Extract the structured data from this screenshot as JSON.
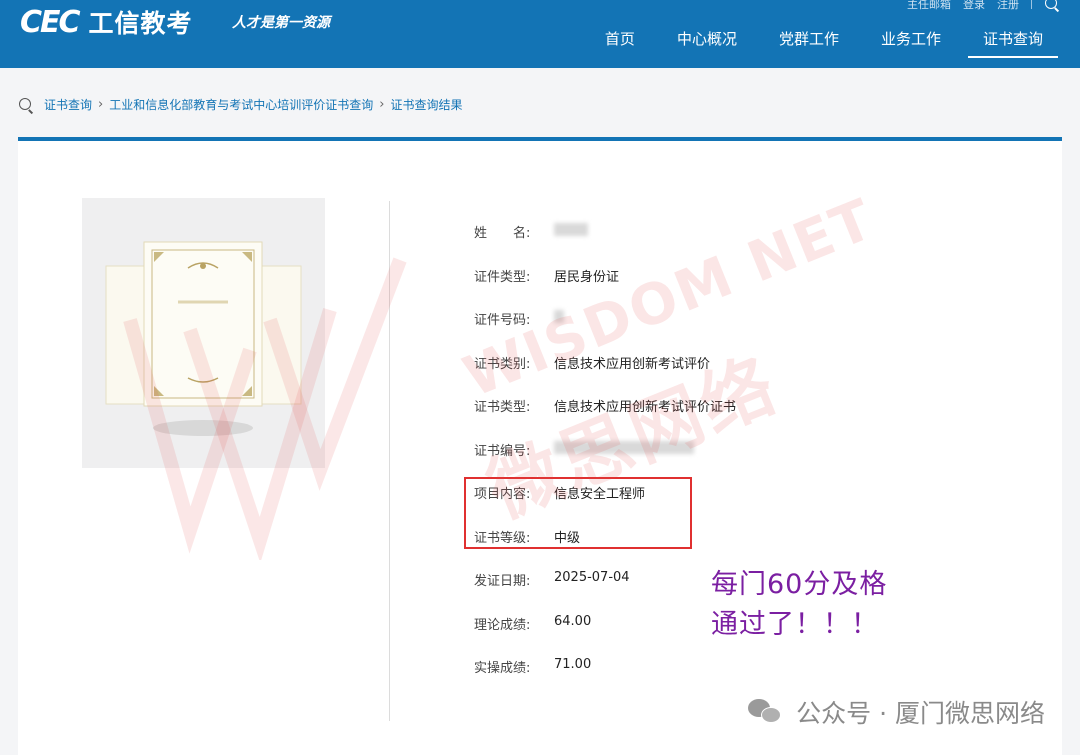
{
  "header": {
    "logo_mark": "CEC",
    "logo_text": "工信教考",
    "slogan": "人才是第一资源",
    "top_links": [
      "主任邮箱",
      "登录",
      "注册"
    ],
    "nav": [
      "首页",
      "中心概况",
      "党群工作",
      "业务工作",
      "证书查询"
    ],
    "active_nav": "证书查询"
  },
  "breadcrumb": [
    "证书查询",
    "工业和信息化部教育与考试中心培训评价证书查询",
    "证书查询结果"
  ],
  "fields": [
    {
      "label": "姓　　名:",
      "value": ""
    },
    {
      "label": "证件类型:",
      "value": "居民身份证"
    },
    {
      "label": "证件号码:",
      "value": ""
    },
    {
      "label": "证书类别:",
      "value": "信息技术应用创新考试评价"
    },
    {
      "label": "证书类型:",
      "value": "信息技术应用创新考试评价证书"
    },
    {
      "label": "证书编号:",
      "value": ""
    },
    {
      "label": "项目内容:",
      "value": "信息安全工程师"
    },
    {
      "label": "证书等级:",
      "value": "中级"
    },
    {
      "label": "发证日期:",
      "value": "2025-07-04"
    },
    {
      "label": "理论成绩:",
      "value": "64.00"
    },
    {
      "label": "实操成绩:",
      "value": "71.00"
    }
  ],
  "annotation": {
    "line1": "每门60分及格",
    "line2": "通过了！！！",
    "color": "#7b1fa2"
  },
  "watermark": {
    "en": "WISDOM NET",
    "cn": "微思网络"
  },
  "footer": {
    "brand": "公众号 · 厦门微思网络",
    "icon": "wechat-icon"
  },
  "colors": {
    "primary": "#1374b5",
    "highlight": "#e03030"
  }
}
